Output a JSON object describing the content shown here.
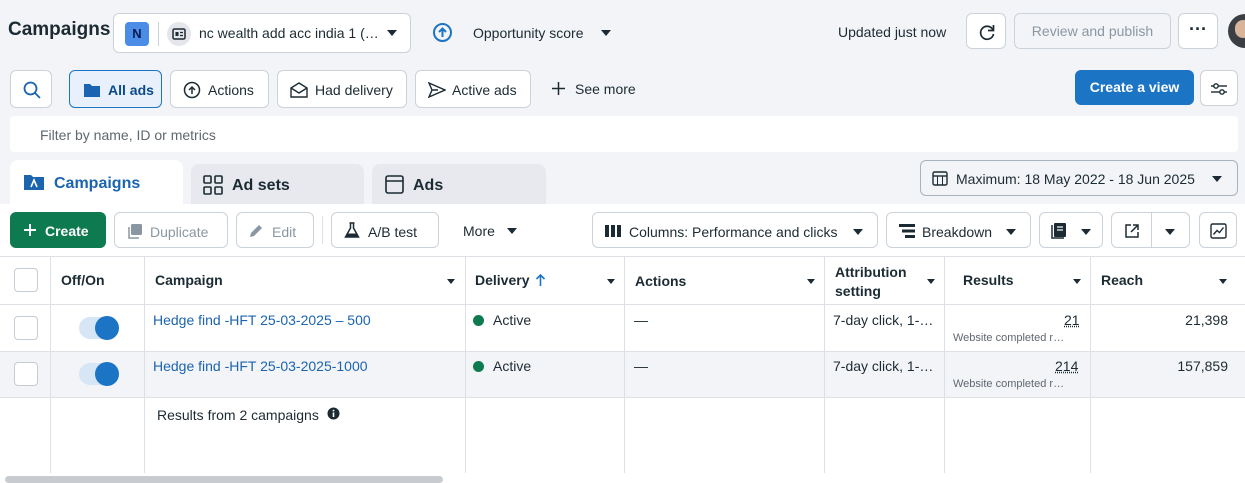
{
  "header": {
    "title": "Campaigns",
    "account_initial": "N",
    "account_name": "nc wealth add acc india 1 (…",
    "opportunity_label": "Opportunity score",
    "updated_text": "Updated just now",
    "review_publish": "Review and publish",
    "more_glyph": "···"
  },
  "filters": {
    "all_ads": "All ads",
    "actions": "Actions",
    "had_delivery": "Had delivery",
    "active_ads": "Active ads",
    "see_more": "See more",
    "create_view": "Create a view",
    "search_placeholder": "Filter by name, ID or metrics"
  },
  "tabs": {
    "campaigns": "Campaigns",
    "ad_sets": "Ad sets",
    "ads": "Ads"
  },
  "date_range": "Maximum: 18 May 2022 - 18 Jun 2025",
  "toolbar": {
    "create": "Create",
    "duplicate": "Duplicate",
    "edit": "Edit",
    "ab_test": "A/B test",
    "more": "More",
    "columns": "Columns: Performance and clicks",
    "breakdown": "Breakdown"
  },
  "table": {
    "headers": {
      "off_on": "Off/On",
      "campaign": "Campaign",
      "delivery": "Delivery",
      "actions": "Actions",
      "attribution_1": "Attribution",
      "attribution_2": "setting",
      "results": "Results",
      "reach": "Reach"
    },
    "rows": [
      {
        "campaign": "Hedge find -HFT 25-03-2025 – 500",
        "delivery": "Active",
        "actions": "—",
        "attribution": "7-day click, 1-…",
        "results": "21",
        "results_sub": "Website completed r…",
        "reach": "21,398"
      },
      {
        "campaign": "Hedge find -HFT 25-03-2025-1000",
        "delivery": "Active",
        "actions": "—",
        "attribution": "7-day click, 1-…",
        "results": "214",
        "results_sub": "Website completed r…",
        "reach": "157,859"
      }
    ],
    "summary": "Results from 2 campaigns"
  }
}
